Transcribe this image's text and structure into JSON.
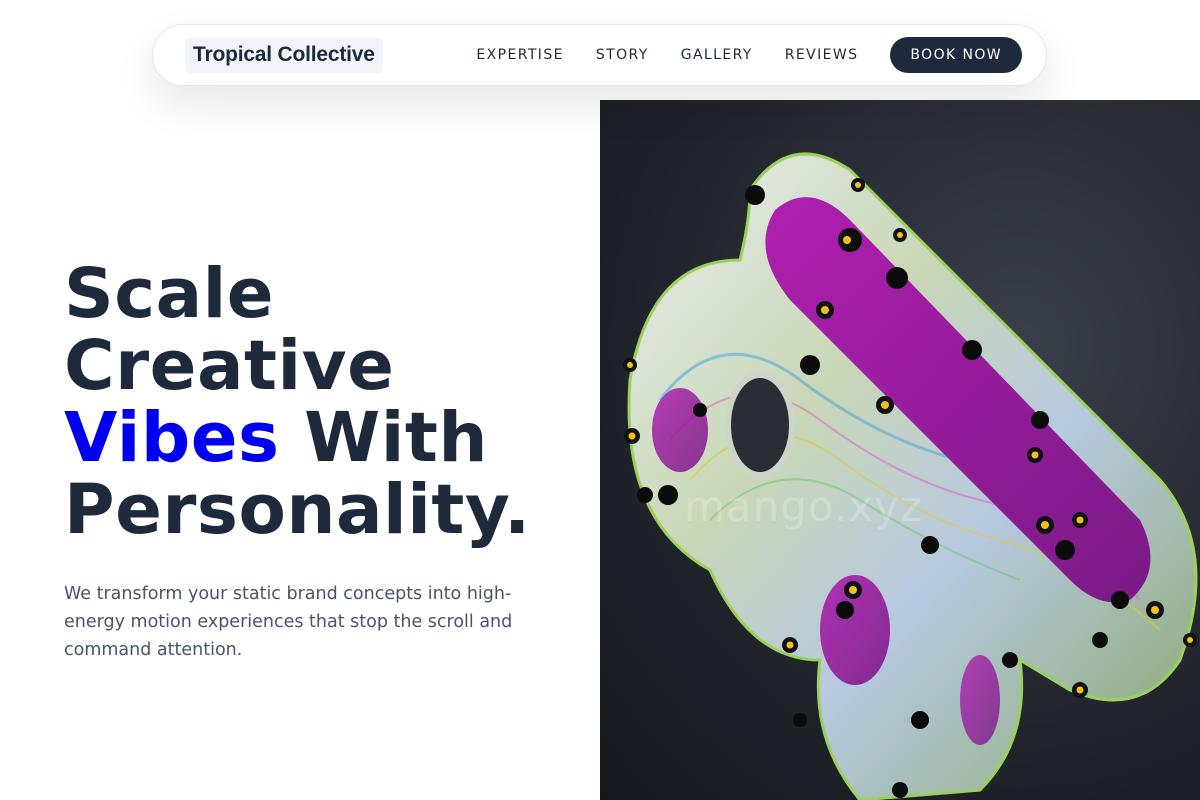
{
  "nav": {
    "brand": "Tropical Collective",
    "links": [
      "EXPERTISE",
      "STORY",
      "GALLERY",
      "REVIEWS"
    ],
    "cta": "BOOK NOW"
  },
  "hero": {
    "headline_line1": "Scale",
    "headline_line2": "Creative",
    "headline_accent": "Vibes",
    "headline_line3_rest": " With",
    "headline_line4": "Personality.",
    "subtext": "We transform your static brand concepts into high-energy motion experiences that stop the scroll and command attention.",
    "accent_color": "#0000ee"
  },
  "art": {
    "watermark": "mango.xyz",
    "background_color": "#23262e"
  }
}
